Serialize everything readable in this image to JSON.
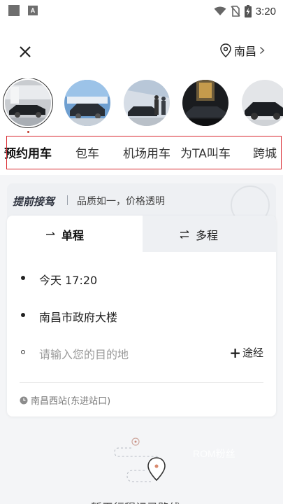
{
  "status_bar": {
    "time": "3:20",
    "icons": [
      "square-notification-icon",
      "a-app-icon",
      "wifi-icon",
      "no-sim-icon",
      "battery-charging-icon"
    ],
    "app_badge": "A"
  },
  "header": {
    "close_icon": "close-icon",
    "city": "南昌",
    "location_icon": "map-pin-icon",
    "chevron_icon": "chevron-right-icon"
  },
  "services": {
    "items": [
      {
        "label": "预约用车",
        "selected": true
      },
      {
        "label": "包车",
        "selected": false
      },
      {
        "label": "机场用车",
        "selected": false
      },
      {
        "label": "为TA叫车",
        "selected": false
      },
      {
        "label": "跨城",
        "selected": false
      }
    ],
    "highlight_color": "#d9272e"
  },
  "banner": {
    "title": "提前接驾",
    "subtitle": "品质如一，价格透明"
  },
  "trip_tabs": {
    "single": "单程",
    "multi": "多程"
  },
  "form": {
    "time": "今天 17:20",
    "start": "南昌市政府大楼",
    "destination_placeholder": "请输入您的目的地",
    "waypoint": "途经"
  },
  "recent": {
    "label": "南昌西站(东进站口)"
  },
  "watermark": "ROM粉丝",
  "bottom_text": "暂无行程记录路线",
  "colors": {
    "accent": "#d9272e",
    "start_dot": "#222222",
    "end_dot": "#333333",
    "page_bg": "#f4f5f7"
  }
}
